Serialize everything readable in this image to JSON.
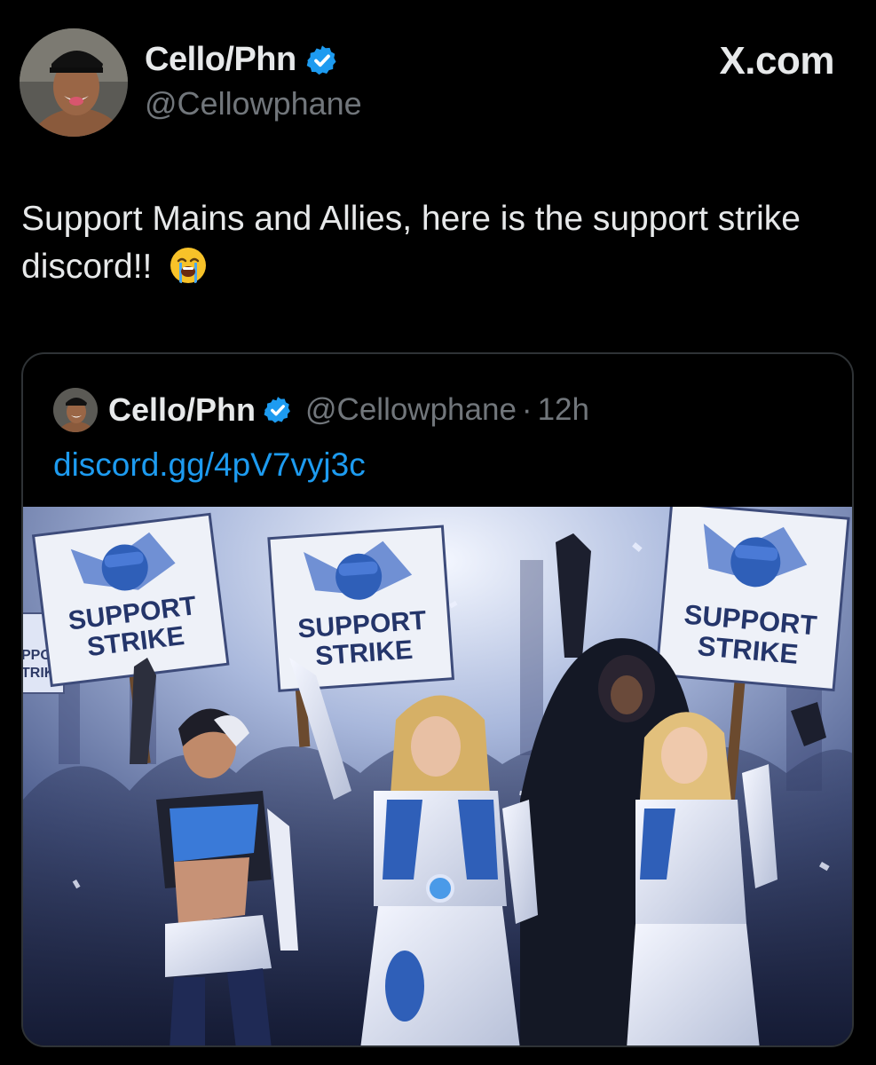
{
  "tweet": {
    "author": {
      "display_name": "Cello/Phn",
      "handle": "@Cellowphane",
      "verified": true
    },
    "brand": "X.com",
    "text": "Support Mains and Allies, here is the support strike discord!!",
    "emoji": "loudly-crying-face"
  },
  "quoted": {
    "author": {
      "display_name": "Cello/Phn",
      "handle": "@Cellowphane",
      "verified": true
    },
    "separator": "·",
    "time": "12h",
    "link": "discord.gg/4pV7vyj3c",
    "image": {
      "signs": [
        {
          "line1": "SUPPORT",
          "line2": "STRIKE"
        },
        {
          "line1": "SUPPORT",
          "line2": "STRIKE"
        },
        {
          "line1": "SUPPORT",
          "line2": "STRIKE"
        }
      ],
      "background_sign_fragment": {
        "line1": "PPO",
        "line2": "TRIK"
      }
    }
  },
  "colors": {
    "background": "#000000",
    "text": "#e7e9ea",
    "muted": "#71767b",
    "link": "#1d9bf0",
    "verified": "#1d9bf0",
    "border": "#2f3336"
  }
}
